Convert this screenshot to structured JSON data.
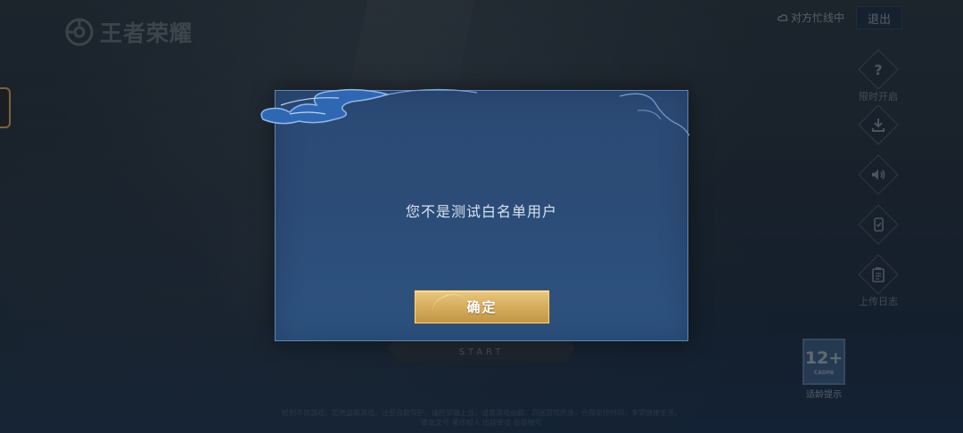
{
  "app": {
    "logo_text": "王者荣耀"
  },
  "top_bar": {
    "net_status": "对方忙线中",
    "exit_label": "退出"
  },
  "side_buttons": [
    {
      "icon": "question-icon",
      "label": "限时开启"
    },
    {
      "icon": "download-icon",
      "label": ""
    },
    {
      "icon": "speaker-icon",
      "label": ""
    },
    {
      "icon": "phone-icon",
      "label": ""
    },
    {
      "icon": "clipboard-icon",
      "label": "上传日志"
    }
  ],
  "background": {
    "start_text": "START",
    "fine_print_1": "抵制不良游戏，拒绝盗版游戏。注意自我保护，谨防受骗上当。适度游戏益脑，沉迷游戏伤身。合理安排时间，享受健康生活。",
    "fine_print_2": "审批文号 著作权人 出版单位 出版物号"
  },
  "age_rating": {
    "number": "12+",
    "org": "CADPA",
    "tip": "适龄提示"
  },
  "dialog": {
    "message": "您不是测试白名单用户",
    "confirm_label": "确定"
  },
  "colors": {
    "modal_bg": "#2c4c77",
    "modal_border": "#5f86b8",
    "button_gold": "#d6ad5e",
    "message_text": "#d6e2f0"
  }
}
